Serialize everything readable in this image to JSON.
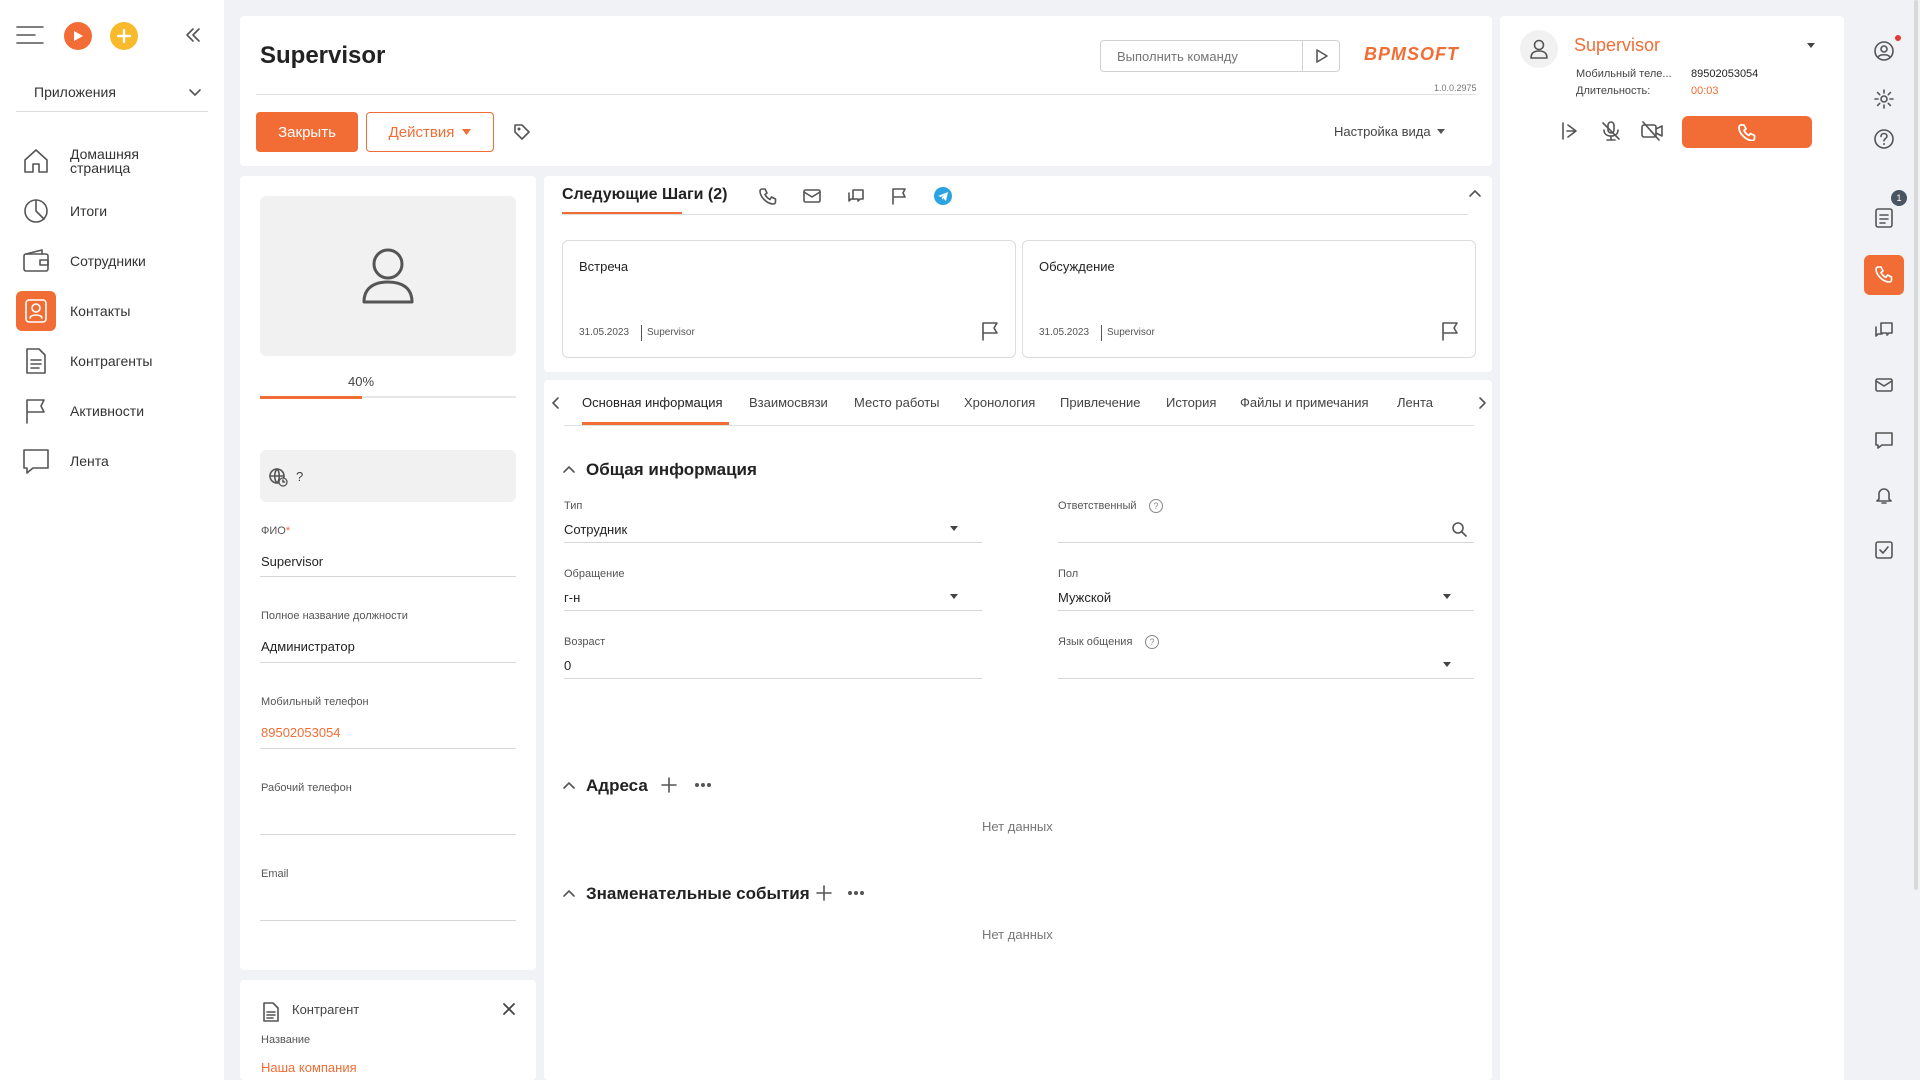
{
  "nav": {
    "apps_label": "Приложения",
    "items": [
      {
        "label_line1": "Домашняя",
        "label_line2": "страница",
        "icon": "home-icon"
      },
      {
        "label_line1": "Итоги",
        "label_line2": "",
        "icon": "pie-chart-icon"
      },
      {
        "label_line1": "Сотрудники",
        "label_line2": "",
        "icon": "wallet-icon"
      },
      {
        "label_line1": "Контакты",
        "label_line2": "",
        "icon": "contact-icon"
      },
      {
        "label_line1": "Контрагенты",
        "label_line2": "",
        "icon": "document-icon"
      },
      {
        "label_line1": "Активности",
        "label_line2": "",
        "icon": "flag-icon"
      },
      {
        "label_line1": "Лента",
        "label_line2": "",
        "icon": "chat-icon"
      }
    ]
  },
  "header": {
    "title": "Supervisor",
    "command_placeholder": "Выполнить команду",
    "brand": "BPMSOFT",
    "version": "1.0.0.2975",
    "close_label": "Закрыть",
    "actions_label": "Действия",
    "view_settings_label": "Настройка вида"
  },
  "profile": {
    "progress_label": "40%",
    "progress_value": 40,
    "timezone_value": "?",
    "fio_label": "ФИО",
    "fio_required": "*",
    "fio_value": "Supervisor",
    "position_label": "Полное название должности",
    "position_value": "Администратор",
    "mobile_label": "Мобильный телефон",
    "mobile_value": "89502053054",
    "work_phone_label": "Рабочий телефон",
    "work_phone_value": "",
    "email_label": "Email",
    "email_value": ""
  },
  "account": {
    "title": "Контрагент",
    "name_label": "Название",
    "name_value": "Наша компания"
  },
  "next_steps": {
    "title": "Следующие Шаги (2)",
    "items": [
      {
        "title": "Встреча",
        "date": "31.05.2023",
        "owner": "Supervisor"
      },
      {
        "title": "Обсуждение",
        "date": "31.05.2023",
        "owner": "Supervisor"
      }
    ]
  },
  "tabs": [
    "Основная информация",
    "Взаимосвязи",
    "Место работы",
    "Хронология",
    "Привлечение",
    "История",
    "Файлы и примечания",
    "Лента"
  ],
  "general": {
    "title": "Общая информация",
    "type_label": "Тип",
    "type_value": "Сотрудник",
    "owner_label": "Ответственный",
    "owner_value": "",
    "salutation_label": "Обращение",
    "salutation_value": "г-н",
    "gender_label": "Пол",
    "gender_value": "Мужской",
    "age_label": "Возраст",
    "age_value": "0",
    "language_label": "Язык общения",
    "language_value": ""
  },
  "addresses": {
    "title": "Адреса",
    "empty": "Нет данных"
  },
  "events": {
    "title": "Знаменательные события",
    "empty": "Нет данных"
  },
  "call": {
    "name": "Supervisor",
    "mobile_label": "Мобильный теле...",
    "mobile_value": "89502053054",
    "duration_label": "Длительность:",
    "duration_value": "00:03"
  },
  "rail": {
    "badge_count": "1"
  },
  "colors": {
    "accent": "#f26d35",
    "link": "#f26d35"
  }
}
